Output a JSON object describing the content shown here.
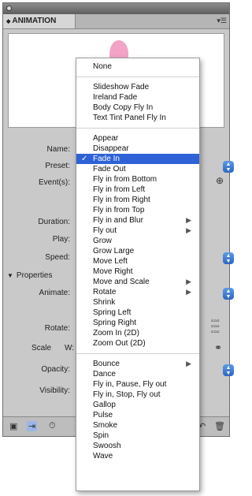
{
  "panel": {
    "tab_title": "ANIMATION",
    "tab_arrows": "⬍"
  },
  "fields": {
    "name": "Name:",
    "preset": "Preset:",
    "events": "Event(s):",
    "duration": "Duration:",
    "play": "Play:",
    "speed": "Speed:",
    "properties": "Properties",
    "animate": "Animate:",
    "rotate": "Rotate:",
    "scale": "Scale",
    "scale_w": "W:",
    "opacity": "Opacity:",
    "visibility": "Visibility:"
  },
  "menu": {
    "groups": [
      [
        "None"
      ],
      [
        "Slideshow Fade",
        "Ireland Fade",
        "Body Copy Fly In",
        "Text Tint Panel Fly In"
      ],
      [
        "Appear",
        "Disappear",
        "Fade In",
        "Fade Out",
        "Fly in from Bottom",
        "Fly in from Left",
        "Fly in from Right",
        "Fly in from Top",
        "Fly in and Blur",
        "Fly out",
        "Grow",
        "Grow Large",
        "Move Left",
        "Move Right",
        "Move and Scale",
        "Rotate",
        "Shrink",
        "Spring Left",
        "Spring Right",
        "Zoom In (2D)",
        "Zoom Out (2D)"
      ],
      [
        "Bounce",
        "Dance",
        "Fly in, Pause, Fly out",
        "Fly in, Stop, Fly out",
        "Gallop",
        "Pulse",
        "Smoke",
        "Spin",
        "Swoosh",
        "Wave"
      ]
    ],
    "selected": "Fade In",
    "with_submenu": [
      "Fly in and Blur",
      "Fly out",
      "Move and Scale",
      "Rotate",
      "Bounce"
    ]
  },
  "colors": {
    "selection": "#2e62d6",
    "stepper": "#3a7bd5",
    "preview_shape": "#f2a3c6"
  }
}
